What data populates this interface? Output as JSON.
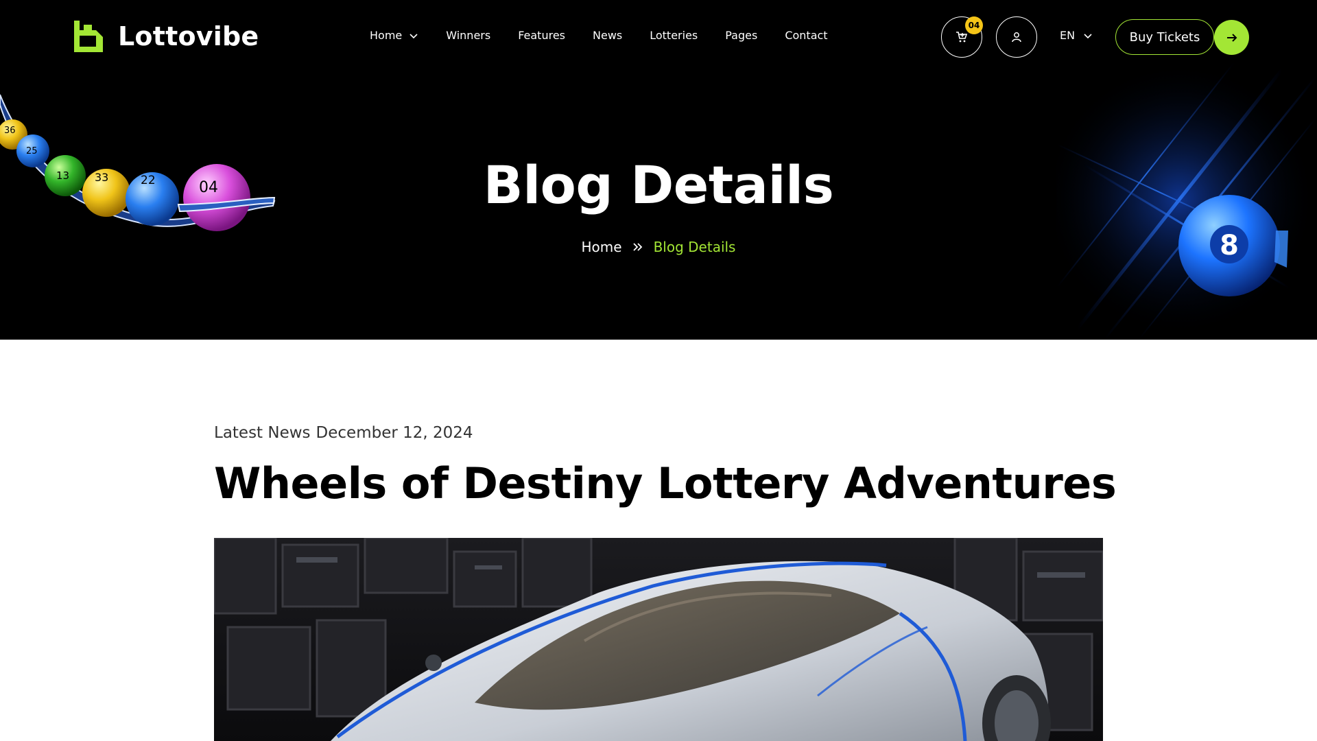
{
  "brand": {
    "name": "Lottovibe",
    "accent": "#a3e635"
  },
  "nav": {
    "items": [
      {
        "label": "Home",
        "has_dropdown": true
      },
      {
        "label": "Winners"
      },
      {
        "label": "Features"
      },
      {
        "label": "News"
      },
      {
        "label": "Lotteries"
      },
      {
        "label": "Pages"
      },
      {
        "label": "Contact"
      }
    ]
  },
  "header": {
    "cart_count": "04",
    "language": "EN",
    "buy_label": "Buy Tickets",
    "icons": [
      "cart-icon",
      "user-icon",
      "chevron-down-icon",
      "arrow-right-icon"
    ]
  },
  "hero": {
    "title": "Blog Details",
    "breadcrumb": {
      "home": "Home",
      "current": "Blog Details"
    },
    "lottery_balls": [
      "36",
      "25",
      "13",
      "33",
      "22",
      "04"
    ],
    "feature_ball": "8"
  },
  "article": {
    "category": "Latest News",
    "date": "December 12, 2024",
    "title": "Wheels of Destiny Lottery Adventures",
    "image": "car-photo"
  }
}
